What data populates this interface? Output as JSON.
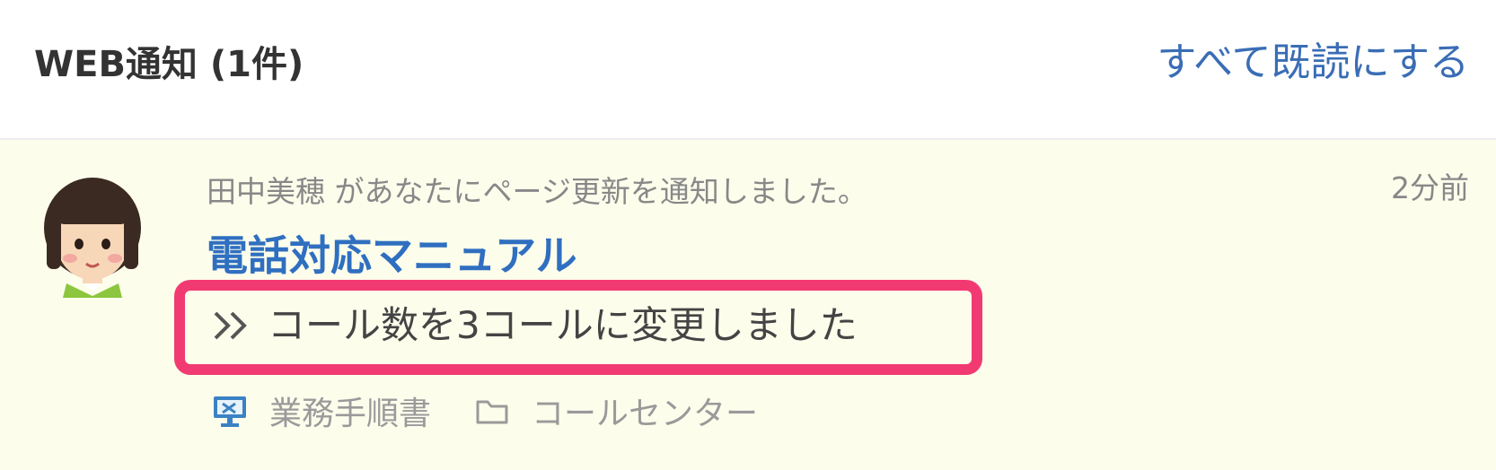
{
  "header": {
    "title": "WEB通知 (1件)",
    "mark_all_read": "すべて既読にする"
  },
  "notification": {
    "actor_line": "田中美穂 があなたにページ更新を通知しました。",
    "time": "2分前",
    "page_title": "電話対応マニュアル",
    "change_note": "コール数を3コールに変更しました",
    "category": "業務手順書",
    "folder": "コールセンター"
  },
  "colors": {
    "link_blue": "#2f6fc0",
    "highlight": "#f23a72",
    "item_background": "#fdfdec"
  },
  "icons": {
    "avatar": "avatar",
    "change": "double-chevron-right-icon",
    "category": "monitor-tools-icon",
    "folder": "folder-icon"
  }
}
